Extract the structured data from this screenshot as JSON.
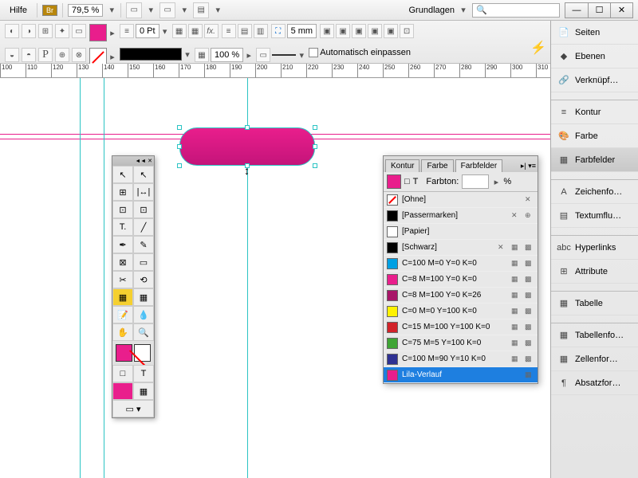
{
  "menu": {
    "help": "Hilfe",
    "workspace": "Grundlagen",
    "br": "Br"
  },
  "zoom": "79,5 %",
  "search_placeholder": "Suchen",
  "controlbar": {
    "stroke_pt": "0 Pt",
    "pct": "100 %",
    "fitfield": "5 mm",
    "auto_fit": "Automatisch einpassen"
  },
  "ruler_ticks": [
    "100",
    "110",
    "120",
    "130",
    "140",
    "150",
    "160",
    "170",
    "180",
    "190",
    "200",
    "210",
    "220",
    "230",
    "240",
    "250",
    "260",
    "270",
    "280",
    "290",
    "300",
    "310"
  ],
  "rightpanel": [
    {
      "label": "Seiten",
      "icon": "📄"
    },
    {
      "label": "Ebenen",
      "icon": "◆"
    },
    {
      "label": "Verknüpf…",
      "icon": "🔗"
    },
    {
      "label": "Kontur",
      "icon": "≡"
    },
    {
      "label": "Farbe",
      "icon": "🎨"
    },
    {
      "label": "Farbfelder",
      "icon": "▦",
      "active": true
    },
    {
      "label": "Zeichenfo…",
      "icon": "A"
    },
    {
      "label": "Textumflu…",
      "icon": "▤"
    },
    {
      "label": "Hyperlinks",
      "icon": "abc"
    },
    {
      "label": "Attribute",
      "icon": "⊞"
    },
    {
      "label": "Tabelle",
      "icon": "▦"
    },
    {
      "label": "Tabellenfo…",
      "icon": "▦"
    },
    {
      "label": "Zellenfor…",
      "icon": "▦"
    },
    {
      "label": "Absatzfor…",
      "icon": "¶"
    }
  ],
  "swatchpanel": {
    "tabs": [
      "Kontur",
      "Farbe",
      "Farbfelder"
    ],
    "active_tab": 2,
    "tint_label": "Farbton:",
    "tint_unit": "%",
    "rows": [
      {
        "name": "[Ohne]",
        "color": "none",
        "locked": true
      },
      {
        "name": "[Passermarken]",
        "color": "#000",
        "locked": true,
        "reg": true
      },
      {
        "name": "[Papier]",
        "color": "#fff"
      },
      {
        "name": "[Schwarz]",
        "color": "#000",
        "locked": true,
        "cmyk": true
      },
      {
        "name": "C=100 M=0 Y=0 K=0",
        "color": "#00a0e3",
        "cmyk": true
      },
      {
        "name": "C=8 M=100 Y=0 K=0",
        "color": "#e91e8c",
        "cmyk": true
      },
      {
        "name": "C=8 M=100 Y=0 K=26",
        "color": "#a81568",
        "cmyk": true
      },
      {
        "name": "C=0 M=0 Y=100 K=0",
        "color": "#fff200",
        "cmyk": true
      },
      {
        "name": "C=15 M=100 Y=100 K=0",
        "color": "#d2232a",
        "cmyk": true
      },
      {
        "name": "C=75 M=5 Y=100 K=0",
        "color": "#3fa535",
        "cmyk": true
      },
      {
        "name": "C=100 M=90 Y=10 K=0",
        "color": "#2e3192",
        "cmyk": true
      },
      {
        "name": "Lila-Verlauf",
        "color": "#e91e8c",
        "selected": true,
        "grad": true
      }
    ]
  }
}
